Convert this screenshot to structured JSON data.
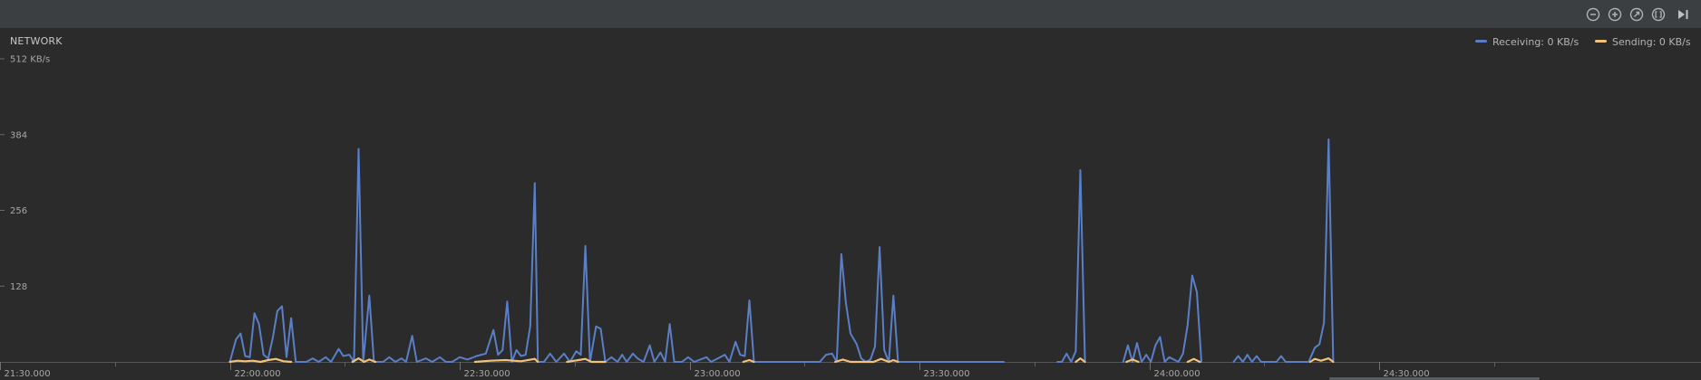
{
  "toolbar": {
    "buttons": [
      {
        "icon": "zoom-out-icon",
        "label": "Zoom out"
      },
      {
        "icon": "zoom-in-icon",
        "label": "Zoom in"
      },
      {
        "icon": "reset-zoom-icon",
        "label": "Reset zoom"
      },
      {
        "icon": "zoom-to-selection-icon",
        "label": "Zoom to selection"
      },
      {
        "icon": "go-live-icon",
        "label": "Go live"
      }
    ]
  },
  "monitor": {
    "title": "NETWORK",
    "legend": [
      {
        "label": "Receiving: 0 KB/s",
        "color": "#5a7fc7"
      },
      {
        "label": "Sending: 0 KB/s",
        "color": "#f2c27a"
      }
    ]
  },
  "chart_data": {
    "type": "line",
    "title": "NETWORK",
    "y_unit": "KB/s",
    "ylim": [
      0,
      512
    ],
    "y_ticks": [
      {
        "value": 512,
        "label": "512 KB/s"
      },
      {
        "value": 384,
        "label": "384"
      },
      {
        "value": 256,
        "label": "256"
      },
      {
        "value": 128,
        "label": "128"
      }
    ],
    "x_range_s": [
      0,
      222
    ],
    "x_ticks": [
      {
        "t": 0,
        "label": "21:30.000"
      },
      {
        "t": 30,
        "label": "22:00.000"
      },
      {
        "t": 60,
        "label": "22:30.000"
      },
      {
        "t": 90,
        "label": "23:00.000"
      },
      {
        "t": 120,
        "label": "23:30.000"
      },
      {
        "t": 150,
        "label": "24:00.000"
      },
      {
        "t": 180,
        "label": "24:30.000"
      }
    ],
    "minor_ticks_s": [
      15,
      45,
      75,
      105,
      135,
      165,
      195
    ],
    "series": [
      {
        "name": "Receiving",
        "color": "#5a7fc7",
        "points": [
          [
            30.0,
            0
          ],
          [
            30.8,
            38
          ],
          [
            31.4,
            48
          ],
          [
            32.0,
            10
          ],
          [
            32.6,
            8
          ],
          [
            33.2,
            82
          ],
          [
            33.8,
            64
          ],
          [
            34.4,
            12
          ],
          [
            35.0,
            6
          ],
          [
            35.6,
            40
          ],
          [
            36.2,
            86
          ],
          [
            36.8,
            94
          ],
          [
            37.4,
            8
          ],
          [
            38.0,
            74
          ],
          [
            38.6,
            0
          ],
          [
            40.0,
            0
          ],
          [
            40.8,
            6
          ],
          [
            41.6,
            0
          ],
          [
            42.5,
            8
          ],
          [
            43.2,
            0
          ],
          [
            44.2,
            22
          ],
          [
            44.8,
            10
          ],
          [
            45.6,
            12
          ],
          [
            46.2,
            0
          ],
          [
            46.8,
            360
          ],
          [
            47.4,
            0
          ],
          [
            48.2,
            112
          ],
          [
            48.8,
            0
          ],
          [
            50.0,
            0
          ],
          [
            50.8,
            8
          ],
          [
            51.6,
            0
          ],
          [
            52.4,
            6
          ],
          [
            53.0,
            0
          ],
          [
            53.8,
            44
          ],
          [
            54.4,
            0
          ],
          [
            55.6,
            6
          ],
          [
            56.4,
            0
          ],
          [
            57.4,
            8
          ],
          [
            58.2,
            0
          ],
          [
            59.0,
            0
          ],
          [
            60.0,
            8
          ],
          [
            61.0,
            4
          ],
          [
            62.2,
            10
          ],
          [
            63.4,
            14
          ],
          [
            64.4,
            54
          ],
          [
            65.0,
            12
          ],
          [
            65.6,
            20
          ],
          [
            66.2,
            102
          ],
          [
            66.8,
            0
          ],
          [
            67.4,
            20
          ],
          [
            68.0,
            10
          ],
          [
            68.6,
            12
          ],
          [
            69.2,
            60
          ],
          [
            69.8,
            302
          ],
          [
            70.2,
            0
          ],
          [
            71.0,
            0
          ],
          [
            71.8,
            14
          ],
          [
            72.6,
            0
          ],
          [
            73.6,
            14
          ],
          [
            74.4,
            0
          ],
          [
            75.2,
            18
          ],
          [
            75.8,
            12
          ],
          [
            76.4,
            196
          ],
          [
            77.0,
            0
          ],
          [
            77.8,
            60
          ],
          [
            78.4,
            56
          ],
          [
            79.0,
            0
          ],
          [
            79.8,
            8
          ],
          [
            80.6,
            0
          ],
          [
            81.2,
            12
          ],
          [
            81.8,
            0
          ],
          [
            82.6,
            14
          ],
          [
            83.2,
            6
          ],
          [
            84.0,
            0
          ],
          [
            84.8,
            28
          ],
          [
            85.4,
            0
          ],
          [
            86.2,
            16
          ],
          [
            86.8,
            0
          ],
          [
            87.4,
            64
          ],
          [
            88.0,
            0
          ],
          [
            89.0,
            0
          ],
          [
            89.8,
            8
          ],
          [
            90.6,
            0
          ],
          [
            92.2,
            8
          ],
          [
            92.8,
            0
          ],
          [
            94.6,
            12
          ],
          [
            95.2,
            0
          ],
          [
            96.0,
            34
          ],
          [
            96.6,
            12
          ],
          [
            97.2,
            10
          ],
          [
            97.8,
            104
          ],
          [
            98.4,
            0
          ],
          [
            101.0,
            0
          ],
          [
            102.0,
            0
          ],
          [
            104.0,
            0
          ],
          [
            105.0,
            0
          ],
          [
            107.0,
            0
          ],
          [
            107.8,
            12
          ],
          [
            108.6,
            14
          ],
          [
            109.2,
            0
          ],
          [
            109.8,
            182
          ],
          [
            110.4,
            100
          ],
          [
            111.0,
            48
          ],
          [
            111.8,
            30
          ],
          [
            112.4,
            6
          ],
          [
            113.0,
            0
          ],
          [
            113.6,
            4
          ],
          [
            114.2,
            26
          ],
          [
            114.8,
            194
          ],
          [
            115.4,
            20
          ],
          [
            116.0,
            0
          ],
          [
            116.6,
            112
          ],
          [
            117.2,
            0
          ],
          [
            118.0,
            0
          ],
          [
            119.0,
            0
          ],
          [
            121.0,
            0
          ],
          [
            122.0,
            0
          ],
          [
            124.0,
            0
          ],
          [
            125.0,
            0
          ],
          [
            126.0,
            0
          ],
          [
            128.0,
            0
          ],
          [
            129.0,
            0
          ],
          [
            130.0,
            0
          ],
          [
            131.0,
            0
          ],
          [
            138.0,
            0
          ],
          [
            138.6,
            0
          ],
          [
            139.2,
            14
          ],
          [
            139.8,
            0
          ],
          [
            140.4,
            18
          ],
          [
            141.0,
            324
          ],
          [
            141.6,
            0
          ],
          [
            146.6,
            0
          ],
          [
            147.2,
            28
          ],
          [
            147.8,
            0
          ],
          [
            148.4,
            32
          ],
          [
            149.0,
            0
          ],
          [
            149.6,
            12
          ],
          [
            150.2,
            0
          ],
          [
            150.8,
            28
          ],
          [
            151.4,
            42
          ],
          [
            152.0,
            0
          ],
          [
            152.6,
            8
          ],
          [
            153.2,
            4
          ],
          [
            153.8,
            0
          ],
          [
            154.4,
            14
          ],
          [
            155.0,
            62
          ],
          [
            155.6,
            146
          ],
          [
            156.2,
            118
          ],
          [
            156.8,
            0
          ],
          [
            161.0,
            0
          ],
          [
            161.6,
            10
          ],
          [
            162.2,
            0
          ],
          [
            162.8,
            12
          ],
          [
            163.4,
            0
          ],
          [
            164.0,
            10
          ],
          [
            164.6,
            0
          ],
          [
            166.6,
            0
          ],
          [
            167.2,
            10
          ],
          [
            167.8,
            0
          ],
          [
            170.0,
            0
          ],
          [
            170.8,
            0
          ],
          [
            171.6,
            24
          ],
          [
            172.2,
            30
          ],
          [
            172.8,
            66
          ],
          [
            173.4,
            376
          ],
          [
            174.0,
            0
          ]
        ]
      },
      {
        "name": "Sending",
        "color": "#f2c27a",
        "points": [
          [
            30.0,
            0
          ],
          [
            31.0,
            2
          ],
          [
            32.0,
            1
          ],
          [
            33.0,
            2
          ],
          [
            34.0,
            0
          ],
          [
            35.0,
            3
          ],
          [
            36.0,
            5
          ],
          [
            37.0,
            1
          ],
          [
            38.0,
            0
          ],
          [
            46.0,
            0
          ],
          [
            46.8,
            6
          ],
          [
            47.5,
            0
          ],
          [
            48.2,
            4
          ],
          [
            49.0,
            0
          ],
          [
            62.0,
            0
          ],
          [
            64.0,
            2
          ],
          [
            66.0,
            3
          ],
          [
            68.0,
            1
          ],
          [
            69.8,
            5
          ],
          [
            70.2,
            0
          ],
          [
            74.0,
            0
          ],
          [
            75.5,
            3
          ],
          [
            76.4,
            5
          ],
          [
            77.2,
            0
          ],
          [
            79.0,
            0
          ],
          [
            97.0,
            0
          ],
          [
            97.8,
            3
          ],
          [
            98.4,
            0
          ],
          [
            109.0,
            0
          ],
          [
            110.0,
            4
          ],
          [
            111.0,
            0
          ],
          [
            114.0,
            0
          ],
          [
            115.0,
            5
          ],
          [
            116.0,
            0
          ],
          [
            116.6,
            3
          ],
          [
            117.2,
            0
          ],
          [
            140.4,
            0
          ],
          [
            141.0,
            6
          ],
          [
            141.6,
            0
          ],
          [
            147.0,
            0
          ],
          [
            147.8,
            4
          ],
          [
            148.6,
            0
          ],
          [
            155.0,
            0
          ],
          [
            155.8,
            5
          ],
          [
            156.6,
            0
          ],
          [
            171.0,
            0
          ],
          [
            171.6,
            5
          ],
          [
            172.4,
            2
          ],
          [
            173.4,
            6
          ],
          [
            174.0,
            0
          ]
        ]
      }
    ]
  }
}
